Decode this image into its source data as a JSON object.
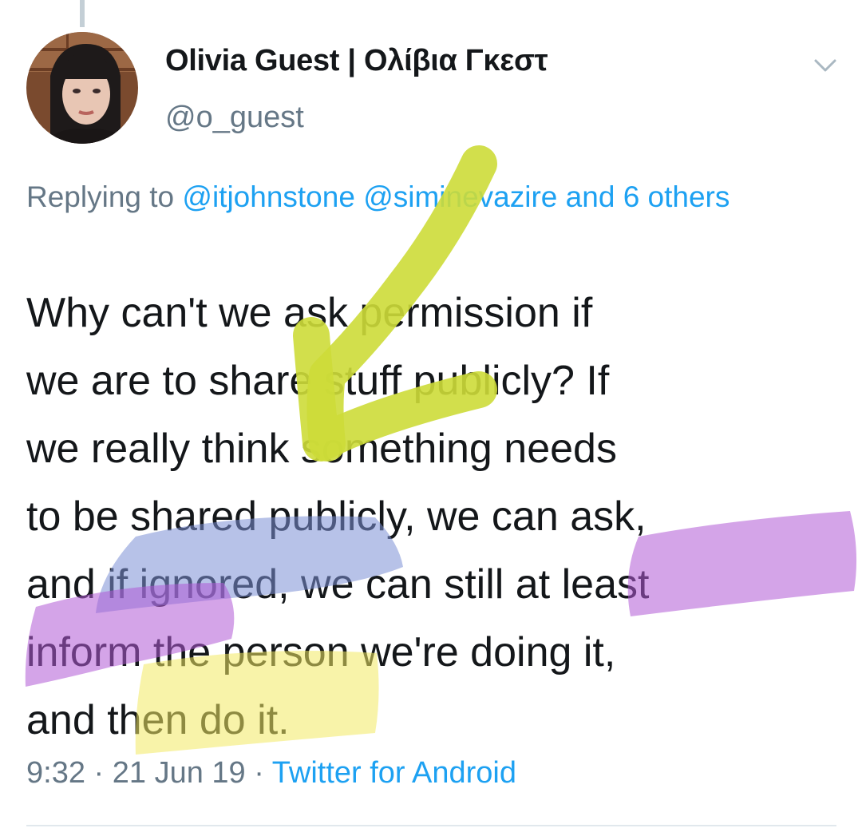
{
  "tweet": {
    "author": {
      "display_name": "Olivia Guest | Ολίβια Γκεστ",
      "handle": "@o_guest",
      "avatar_icon": "profile-photo"
    },
    "reply": {
      "prefix": "Replying to ",
      "mention_1": "@itjohnstone",
      "mention_2": "@siminevazire",
      "connector": "and",
      "others": "6 others"
    },
    "text_lines": [
      "Why can't we ask permission if",
      "we are to share stuff publicly? If",
      "we really think something needs",
      "to be shared publicly, we can ask,",
      "and if ignored, we can still at least",
      "inform the person we're doing it,",
      "and then do it."
    ],
    "meta": {
      "time": "9:32",
      "separator": "·",
      "date": "21 Jun 19",
      "source": "Twitter for Android"
    }
  },
  "colors": {
    "text_primary": "#14171a",
    "text_secondary": "#657786",
    "link": "#1da1f2",
    "arrow_annotation": "#cddc39",
    "highlight_blue": "#7b8fd6",
    "highlight_purple": "#b15ad6",
    "highlight_yellow": "#f3ea63"
  },
  "icons": {
    "caret": "chevron-down-icon"
  }
}
